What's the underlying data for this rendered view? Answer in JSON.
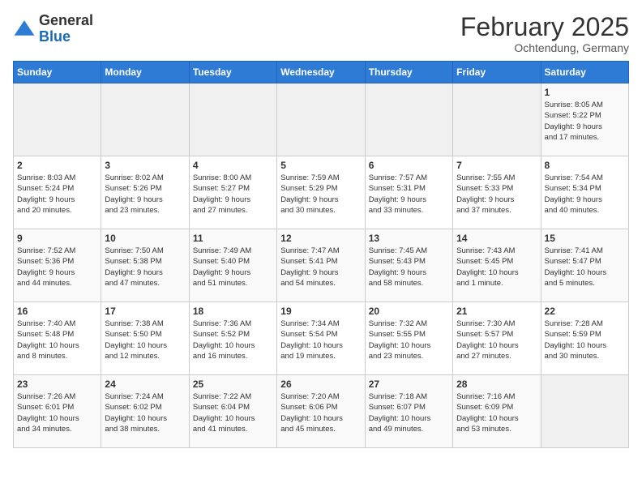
{
  "header": {
    "logo_general": "General",
    "logo_blue": "Blue",
    "month": "February 2025",
    "location": "Ochtendung, Germany"
  },
  "weekdays": [
    "Sunday",
    "Monday",
    "Tuesday",
    "Wednesday",
    "Thursday",
    "Friday",
    "Saturday"
  ],
  "weeks": [
    [
      {
        "day": "",
        "info": ""
      },
      {
        "day": "",
        "info": ""
      },
      {
        "day": "",
        "info": ""
      },
      {
        "day": "",
        "info": ""
      },
      {
        "day": "",
        "info": ""
      },
      {
        "day": "",
        "info": ""
      },
      {
        "day": "1",
        "info": "Sunrise: 8:05 AM\nSunset: 5:22 PM\nDaylight: 9 hours\nand 17 minutes."
      }
    ],
    [
      {
        "day": "2",
        "info": "Sunrise: 8:03 AM\nSunset: 5:24 PM\nDaylight: 9 hours\nand 20 minutes."
      },
      {
        "day": "3",
        "info": "Sunrise: 8:02 AM\nSunset: 5:26 PM\nDaylight: 9 hours\nand 23 minutes."
      },
      {
        "day": "4",
        "info": "Sunrise: 8:00 AM\nSunset: 5:27 PM\nDaylight: 9 hours\nand 27 minutes."
      },
      {
        "day": "5",
        "info": "Sunrise: 7:59 AM\nSunset: 5:29 PM\nDaylight: 9 hours\nand 30 minutes."
      },
      {
        "day": "6",
        "info": "Sunrise: 7:57 AM\nSunset: 5:31 PM\nDaylight: 9 hours\nand 33 minutes."
      },
      {
        "day": "7",
        "info": "Sunrise: 7:55 AM\nSunset: 5:33 PM\nDaylight: 9 hours\nand 37 minutes."
      },
      {
        "day": "8",
        "info": "Sunrise: 7:54 AM\nSunset: 5:34 PM\nDaylight: 9 hours\nand 40 minutes."
      }
    ],
    [
      {
        "day": "9",
        "info": "Sunrise: 7:52 AM\nSunset: 5:36 PM\nDaylight: 9 hours\nand 44 minutes."
      },
      {
        "day": "10",
        "info": "Sunrise: 7:50 AM\nSunset: 5:38 PM\nDaylight: 9 hours\nand 47 minutes."
      },
      {
        "day": "11",
        "info": "Sunrise: 7:49 AM\nSunset: 5:40 PM\nDaylight: 9 hours\nand 51 minutes."
      },
      {
        "day": "12",
        "info": "Sunrise: 7:47 AM\nSunset: 5:41 PM\nDaylight: 9 hours\nand 54 minutes."
      },
      {
        "day": "13",
        "info": "Sunrise: 7:45 AM\nSunset: 5:43 PM\nDaylight: 9 hours\nand 58 minutes."
      },
      {
        "day": "14",
        "info": "Sunrise: 7:43 AM\nSunset: 5:45 PM\nDaylight: 10 hours\nand 1 minute."
      },
      {
        "day": "15",
        "info": "Sunrise: 7:41 AM\nSunset: 5:47 PM\nDaylight: 10 hours\nand 5 minutes."
      }
    ],
    [
      {
        "day": "16",
        "info": "Sunrise: 7:40 AM\nSunset: 5:48 PM\nDaylight: 10 hours\nand 8 minutes."
      },
      {
        "day": "17",
        "info": "Sunrise: 7:38 AM\nSunset: 5:50 PM\nDaylight: 10 hours\nand 12 minutes."
      },
      {
        "day": "18",
        "info": "Sunrise: 7:36 AM\nSunset: 5:52 PM\nDaylight: 10 hours\nand 16 minutes."
      },
      {
        "day": "19",
        "info": "Sunrise: 7:34 AM\nSunset: 5:54 PM\nDaylight: 10 hours\nand 19 minutes."
      },
      {
        "day": "20",
        "info": "Sunrise: 7:32 AM\nSunset: 5:55 PM\nDaylight: 10 hours\nand 23 minutes."
      },
      {
        "day": "21",
        "info": "Sunrise: 7:30 AM\nSunset: 5:57 PM\nDaylight: 10 hours\nand 27 minutes."
      },
      {
        "day": "22",
        "info": "Sunrise: 7:28 AM\nSunset: 5:59 PM\nDaylight: 10 hours\nand 30 minutes."
      }
    ],
    [
      {
        "day": "23",
        "info": "Sunrise: 7:26 AM\nSunset: 6:01 PM\nDaylight: 10 hours\nand 34 minutes."
      },
      {
        "day": "24",
        "info": "Sunrise: 7:24 AM\nSunset: 6:02 PM\nDaylight: 10 hours\nand 38 minutes."
      },
      {
        "day": "25",
        "info": "Sunrise: 7:22 AM\nSunset: 6:04 PM\nDaylight: 10 hours\nand 41 minutes."
      },
      {
        "day": "26",
        "info": "Sunrise: 7:20 AM\nSunset: 6:06 PM\nDaylight: 10 hours\nand 45 minutes."
      },
      {
        "day": "27",
        "info": "Sunrise: 7:18 AM\nSunset: 6:07 PM\nDaylight: 10 hours\nand 49 minutes."
      },
      {
        "day": "28",
        "info": "Sunrise: 7:16 AM\nSunset: 6:09 PM\nDaylight: 10 hours\nand 53 minutes."
      },
      {
        "day": "",
        "info": ""
      }
    ]
  ]
}
